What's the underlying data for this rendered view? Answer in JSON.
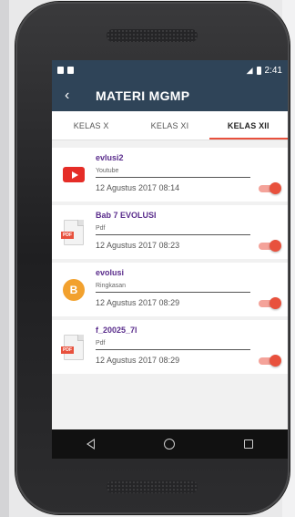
{
  "statusbar": {
    "time": "2:41"
  },
  "appbar": {
    "title": "MATERI MGMP",
    "back_label": "‹"
  },
  "tabs": [
    {
      "label": "KELAS X"
    },
    {
      "label": "KELAS XI"
    },
    {
      "label": "KELAS XII"
    }
  ],
  "active_tab": "KELAS XII",
  "items": [
    {
      "title": "evlusi2",
      "type": "Youtube",
      "date": "12 Agustus 2017 08:14",
      "icon": "youtube-icon",
      "enabled": true
    },
    {
      "title": "Bab 7 EVOLUSI",
      "type": "Pdf",
      "date": "12 Agustus 2017 08:23",
      "icon": "pdf-icon",
      "enabled": true
    },
    {
      "title": "evolusi",
      "type": "Ringkasan",
      "date": "12 Agustus 2017 08:29",
      "icon": "blogger-icon",
      "enabled": true
    },
    {
      "title": "f_20025_7l",
      "type": "Pdf",
      "date": "12 Agustus 2017 08:29",
      "icon": "pdf-icon",
      "enabled": true
    }
  ],
  "colors": {
    "appbar": "#2f4458",
    "accent": "#e8513d",
    "title_text": "#5a2d8c"
  }
}
